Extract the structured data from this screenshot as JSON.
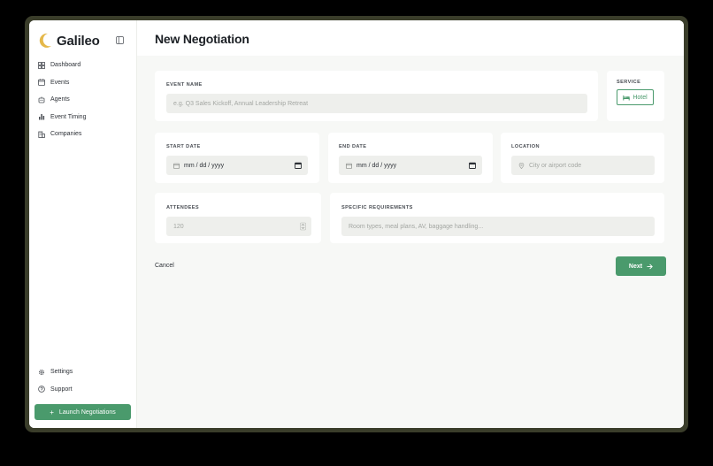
{
  "sidebar": {
    "brand": "Galileo",
    "nav": [
      {
        "label": "Dashboard",
        "icon": "dashboard-grid-icon"
      },
      {
        "label": "Events",
        "icon": "calendar-icon"
      },
      {
        "label": "Agents",
        "icon": "agent-icon"
      },
      {
        "label": "Event Timing",
        "icon": "bar-chart-icon"
      },
      {
        "label": "Companies",
        "icon": "building-icon"
      }
    ],
    "bottom_nav": [
      {
        "label": "Settings",
        "icon": "gear-icon"
      },
      {
        "label": "Support",
        "icon": "help-circle-icon"
      }
    ],
    "launch_button": {
      "plus": "+",
      "label": "Launch Negotiations"
    }
  },
  "main": {
    "title": "New Negotiation",
    "form": {
      "event_name": {
        "label": "EVENT NAME",
        "placeholder": "e.g. Q3 Sales Kickoff, Annual Leadership Retreat"
      },
      "service": {
        "label": "SERVICE",
        "value": "Hotel",
        "icon": "bed-icon"
      },
      "start_date": {
        "label": "START DATE",
        "value": "mm / dd / yyyy"
      },
      "end_date": {
        "label": "END DATE",
        "value": "mm / dd / yyyy"
      },
      "location": {
        "label": "LOCATION",
        "placeholder": "City or airport code",
        "icon": "location-pin-icon"
      },
      "attendees": {
        "label": "ATTENDEES",
        "placeholder": "120"
      },
      "requirements": {
        "label": "SPECIFIC REQUIREMENTS",
        "placeholder": "Room types, meal plans, AV, baggage handling..."
      }
    },
    "cancel_label": "Cancel",
    "next_label": "Next"
  },
  "colors": {
    "accent": "#4a9a6c",
    "logo": "#e5b84a",
    "background": "#f7f8f6",
    "field": "#eeefec"
  }
}
